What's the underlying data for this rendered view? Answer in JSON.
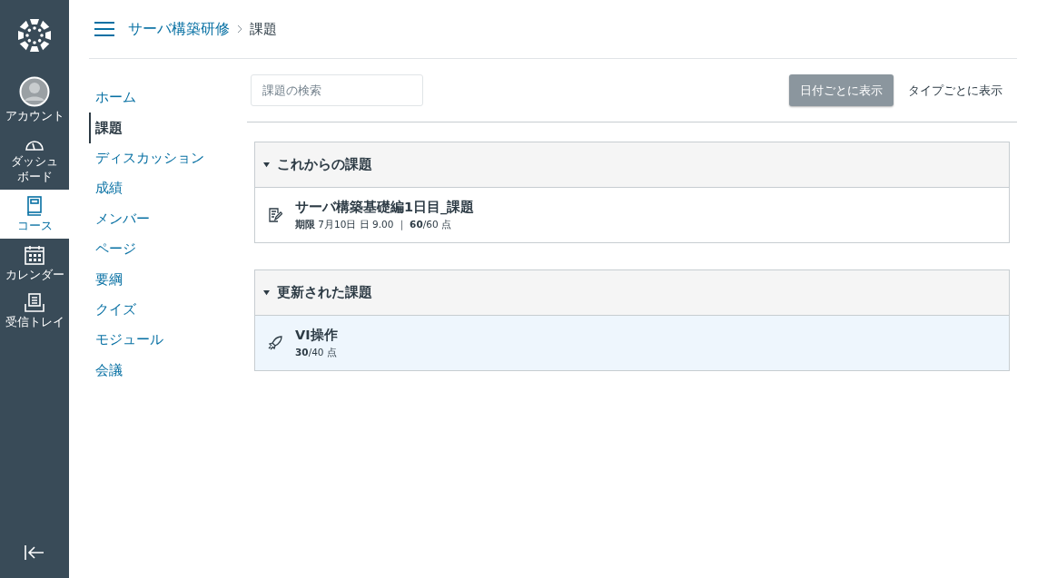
{
  "global_nav": [
    {
      "kind": "account",
      "label": "アカウント",
      "selected": false
    },
    {
      "kind": "dashboard",
      "label": "ダッシュボード",
      "selected": false
    },
    {
      "kind": "courses",
      "label": "コース",
      "selected": true
    },
    {
      "kind": "calendar",
      "label": "カレンダー",
      "selected": false
    },
    {
      "kind": "inbox",
      "label": "受信トレイ",
      "selected": false
    }
  ],
  "breadcrumb": {
    "course": "サーバ構築研修",
    "current": "課題"
  },
  "course_nav": [
    {
      "label": "ホーム",
      "selected": false
    },
    {
      "label": "課題",
      "selected": true
    },
    {
      "label": "ディスカッション",
      "selected": false
    },
    {
      "label": "成績",
      "selected": false
    },
    {
      "label": "メンバー",
      "selected": false
    },
    {
      "label": "ページ",
      "selected": false
    },
    {
      "label": "要綱",
      "selected": false
    },
    {
      "label": "クイズ",
      "selected": false
    },
    {
      "label": "モジュール",
      "selected": false
    },
    {
      "label": "会議",
      "selected": false
    }
  ],
  "search": {
    "placeholder": "課題の検索"
  },
  "view_toggle": [
    {
      "label": "日付ごとに表示",
      "selected": true
    },
    {
      "label": "タイプごとに表示",
      "selected": false
    }
  ],
  "groups": [
    {
      "title": "これからの課題",
      "expanded": true,
      "items": [
        {
          "kind": "assignment",
          "title": "サーバ構築基礎編1日目_課題",
          "meta": "**期限** 7月10日 日 9.00 ｜ **60**/60 点",
          "selected": false
        }
      ]
    },
    {
      "title": "更新された課題",
      "expanded": true,
      "items": [
        {
          "kind": "quiz",
          "title": "VI操作",
          "meta": "**30**/40 点",
          "selected": true
        }
      ]
    }
  ]
}
